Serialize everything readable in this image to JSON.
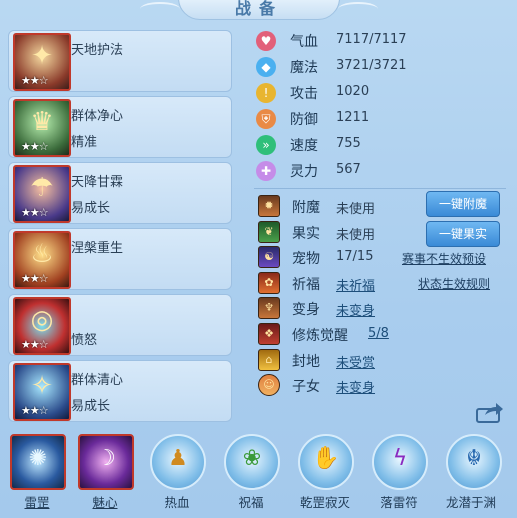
{
  "title": "战备",
  "skills": [
    {
      "name": "天地护法",
      "sub": "",
      "stars": "★★☆",
      "icon": "golden-shield-icon"
    },
    {
      "name": "群体净心",
      "sub": "精准",
      "stars": "★★☆",
      "icon": "green-crown-icon"
    },
    {
      "name": "天降甘霖",
      "sub": "易成长",
      "stars": "★★☆",
      "icon": "rain-figure-icon"
    },
    {
      "name": "涅槃重生",
      "sub": "",
      "stars": "★★☆",
      "icon": "phoenix-icon"
    },
    {
      "name": "",
      "sub": "愤怒",
      "stars": "★★☆",
      "icon": "fire-ring-icon"
    },
    {
      "name": "群体清心",
      "sub": "易成长",
      "stars": "★★☆",
      "icon": "spirit-figure-icon"
    }
  ],
  "stats": [
    {
      "label": "气血",
      "value": "7117/7117",
      "color": "#e2607a",
      "icon": "heart-icon"
    },
    {
      "label": "魔法",
      "value": "3721/3721",
      "color": "#4ab0f0",
      "icon": "mana-icon"
    },
    {
      "label": "攻击",
      "value": "1020",
      "color": "#e8b530",
      "icon": "attack-icon"
    },
    {
      "label": "防御",
      "value": "1211",
      "color": "#e98a45",
      "icon": "defense-icon"
    },
    {
      "label": "速度",
      "value": "755",
      "color": "#2fbf7a",
      "icon": "speed-icon"
    },
    {
      "label": "灵力",
      "value": "567",
      "color": "#c58ce8",
      "icon": "spirit-icon"
    }
  ],
  "rows": [
    {
      "label": "附魔",
      "value": "未使用",
      "icon": "enchant-icon"
    },
    {
      "label": "果实",
      "value": "未使用",
      "icon": "fruit-icon"
    },
    {
      "label": "宠物",
      "value": "17/15",
      "icon": "pet-icon"
    },
    {
      "label": "祈福",
      "value": "未祈福",
      "icon": "blessing-icon"
    },
    {
      "label": "变身",
      "value": "未变身",
      "icon": "transform-icon"
    },
    {
      "label": "修炼觉醒",
      "value": "5/8",
      "icon": "cultivation-icon"
    },
    {
      "label": "封地",
      "value": "未受赏",
      "icon": "fief-icon"
    },
    {
      "label": "子女",
      "value": "未变身",
      "icon": "children-icon"
    }
  ],
  "buttons": {
    "enchant": "一键附魔",
    "fruit": "一键果实"
  },
  "links": {
    "preset": "赛事不生效预设",
    "rules": "状态生效规则"
  },
  "bottom": [
    {
      "label": "雷罡",
      "icon": "thunder-orb-icon"
    },
    {
      "label": "魅心",
      "icon": "charm-icon"
    },
    {
      "label": "热血",
      "icon": "hot-blood-icon"
    },
    {
      "label": "祝福",
      "icon": "bless-icon"
    },
    {
      "label": "乾罡寂灭",
      "icon": "annihilate-icon"
    },
    {
      "label": "落雷符",
      "icon": "thunder-talisman-icon"
    },
    {
      "label": "龙潜于渊",
      "icon": "dragon-icon"
    }
  ]
}
